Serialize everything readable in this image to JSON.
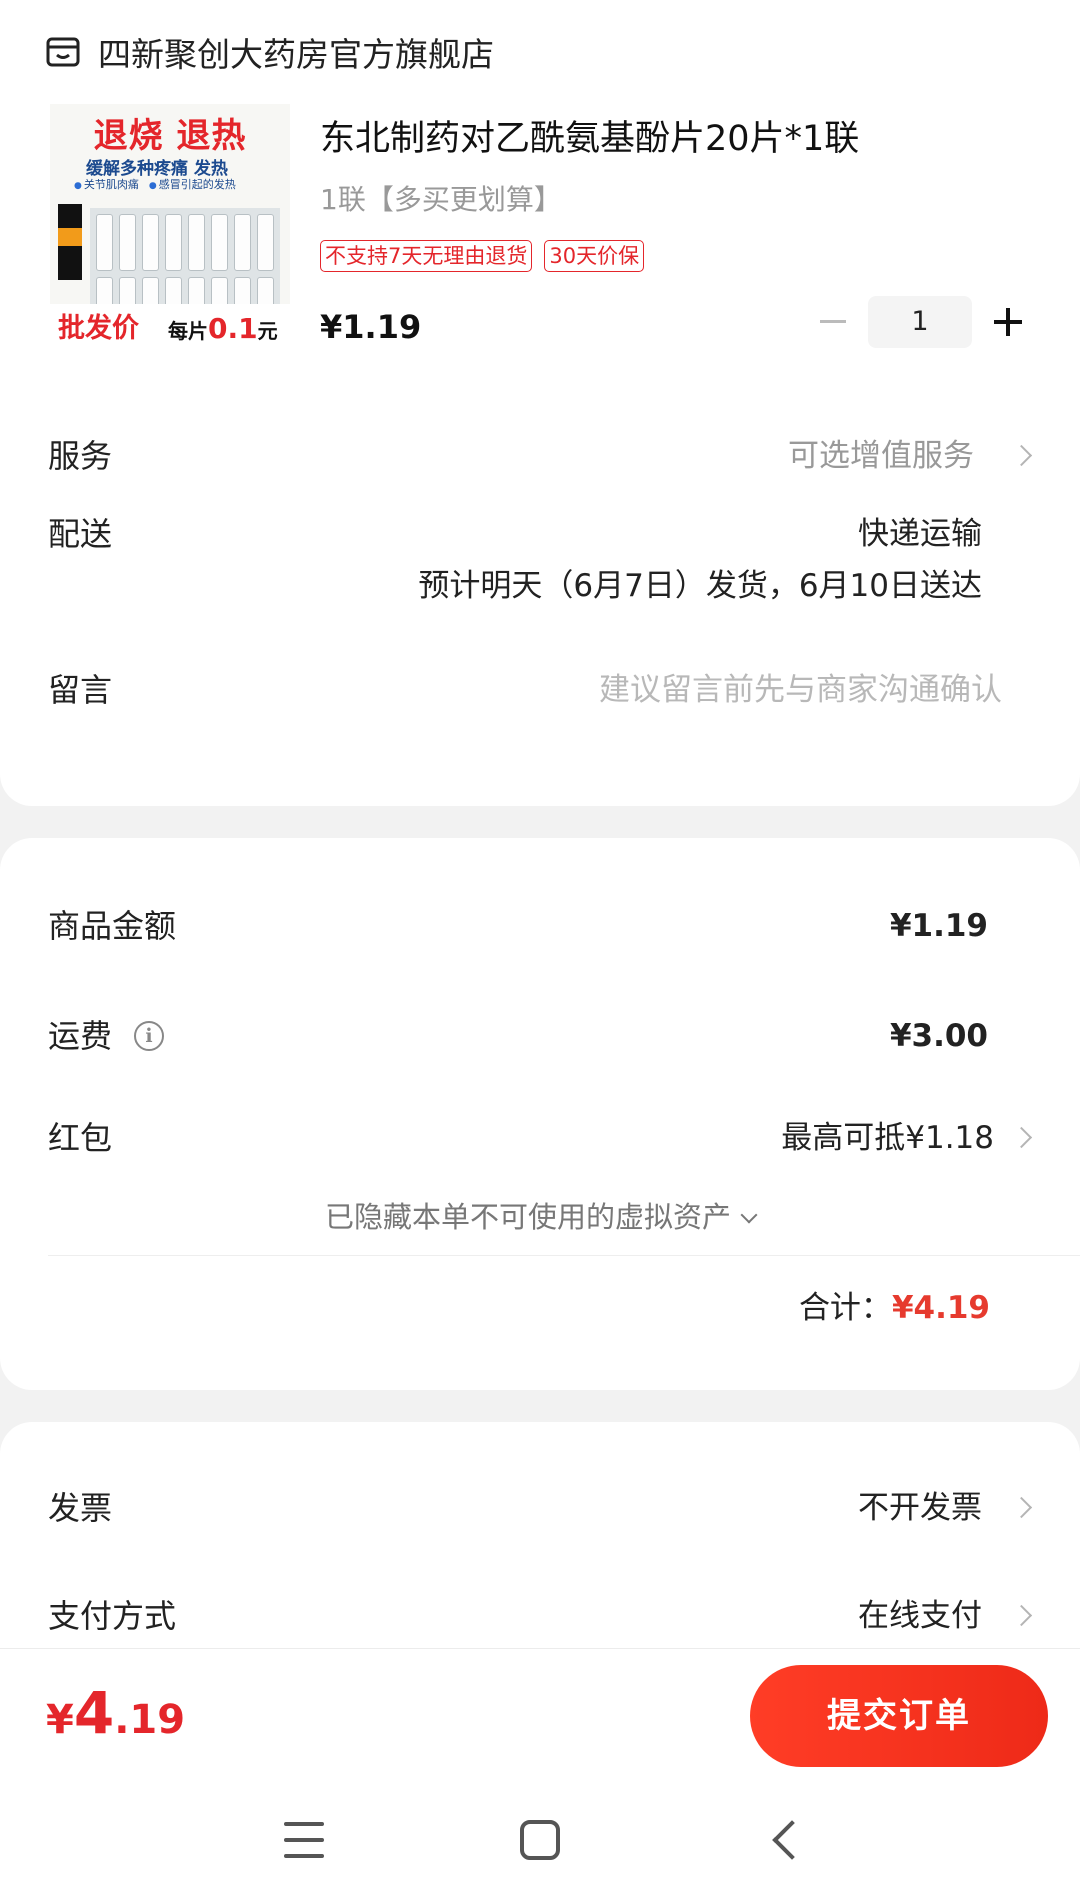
{
  "shop": {
    "name": "四新聚创大药房官方旗舰店",
    "icon": "shop-icon"
  },
  "product": {
    "title": "东北制药对乙酰氨基酚片20片*1联",
    "spec": "1联【多买更划算】",
    "tags": [
      "不支持7天无理由退货",
      "30天价保"
    ],
    "price": "¥1.19",
    "quantity": "1",
    "image": {
      "headline": "退烧 退热",
      "subline": "缓解多种疼痛 发热",
      "tags": [
        "关节肌肉痛",
        "感冒引起的发热"
      ],
      "bulk_label": "批发价",
      "each_prefix": "每片",
      "each_value": "0.1",
      "each_unit": "元"
    }
  },
  "service": {
    "label": "服务",
    "value": "可选增值服务"
  },
  "delivery": {
    "label": "配送",
    "method": "快递运输",
    "estimate": "预计明天（6月7日）发货，6月10日送达"
  },
  "message": {
    "label": "留言",
    "placeholder": "建议留言前先与商家沟通确认"
  },
  "amount": {
    "goods_label": "商品金额",
    "goods_value": "¥1.19",
    "shipping_label": "运费",
    "shipping_value": "¥3.00",
    "redpacket_label": "红包",
    "redpacket_value": "最高可抵¥1.18",
    "hidden_assets": "已隐藏本单不可使用的虚拟资产",
    "total_label": "合计：",
    "total_value": "¥4.19"
  },
  "invoice": {
    "label": "发票",
    "value": "不开发票"
  },
  "payment": {
    "label": "支付方式",
    "value": "在线支付"
  },
  "bottom": {
    "currency": "¥",
    "price_int": "4",
    "price_dec": ".19",
    "submit_label": "提交订单"
  },
  "colors": {
    "accent": "#e4262b",
    "button": "#ee2a18"
  }
}
